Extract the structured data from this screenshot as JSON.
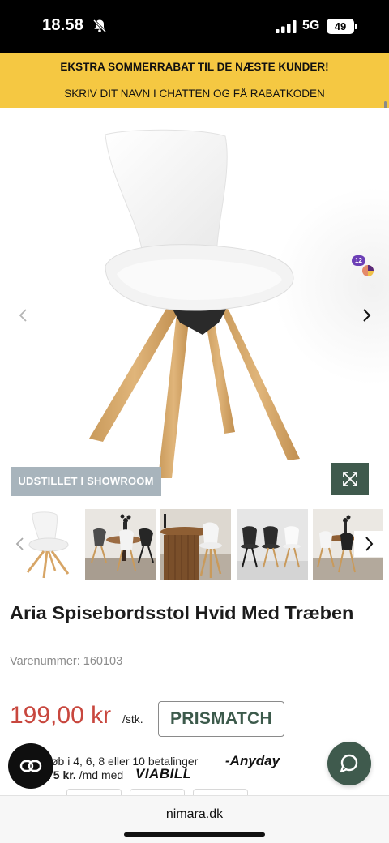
{
  "status_bar": {
    "time": "18.58",
    "network": "5G",
    "battery": "49",
    "icons": [
      "bell-muted-icon",
      "signal-icon",
      "battery-icon"
    ]
  },
  "promo": {
    "line1": "EKSTRA SOMMERRABAT TIL DE NÆSTE KUNDER!",
    "line2": "SKRIV DIT NAVN I CHATTEN OG FÅ RABATKODEN",
    "background": "#f5c842"
  },
  "gallery": {
    "showroom_tag": "UDSTILLET I SHOWROOM",
    "widget_badge": "12",
    "icons": [
      "chevron-left-icon",
      "chevron-right-icon",
      "expand-icon"
    ],
    "thumbnails": [
      "white-chair-wood-legs",
      "dining-room-round-table-chairs",
      "white-chair-at-round-wooden-table",
      "black-and-white-chairs-row",
      "dining-room-chairs-lifestyle"
    ]
  },
  "product": {
    "title": "Aria Spisebordsstol Hvid Med Træben",
    "sku_label": "Varenummer:",
    "sku_value": "160103",
    "price": "199,00 kr",
    "price_unit": "/stk.",
    "prismatch": "PRISMATCH"
  },
  "payment": {
    "installment_text": "køb i 4, 6, 8 eller 10 betalinger",
    "anyday": "Anyday",
    "viabill_amount": "75 kr.",
    "viabill_text": "/md med",
    "viabill": "VIABILL"
  },
  "browser": {
    "url": "nimara.dk"
  },
  "colors": {
    "price": "#c8473e",
    "brand_green": "#3f5a4d",
    "showroom_tag": "#a8b4bc"
  }
}
